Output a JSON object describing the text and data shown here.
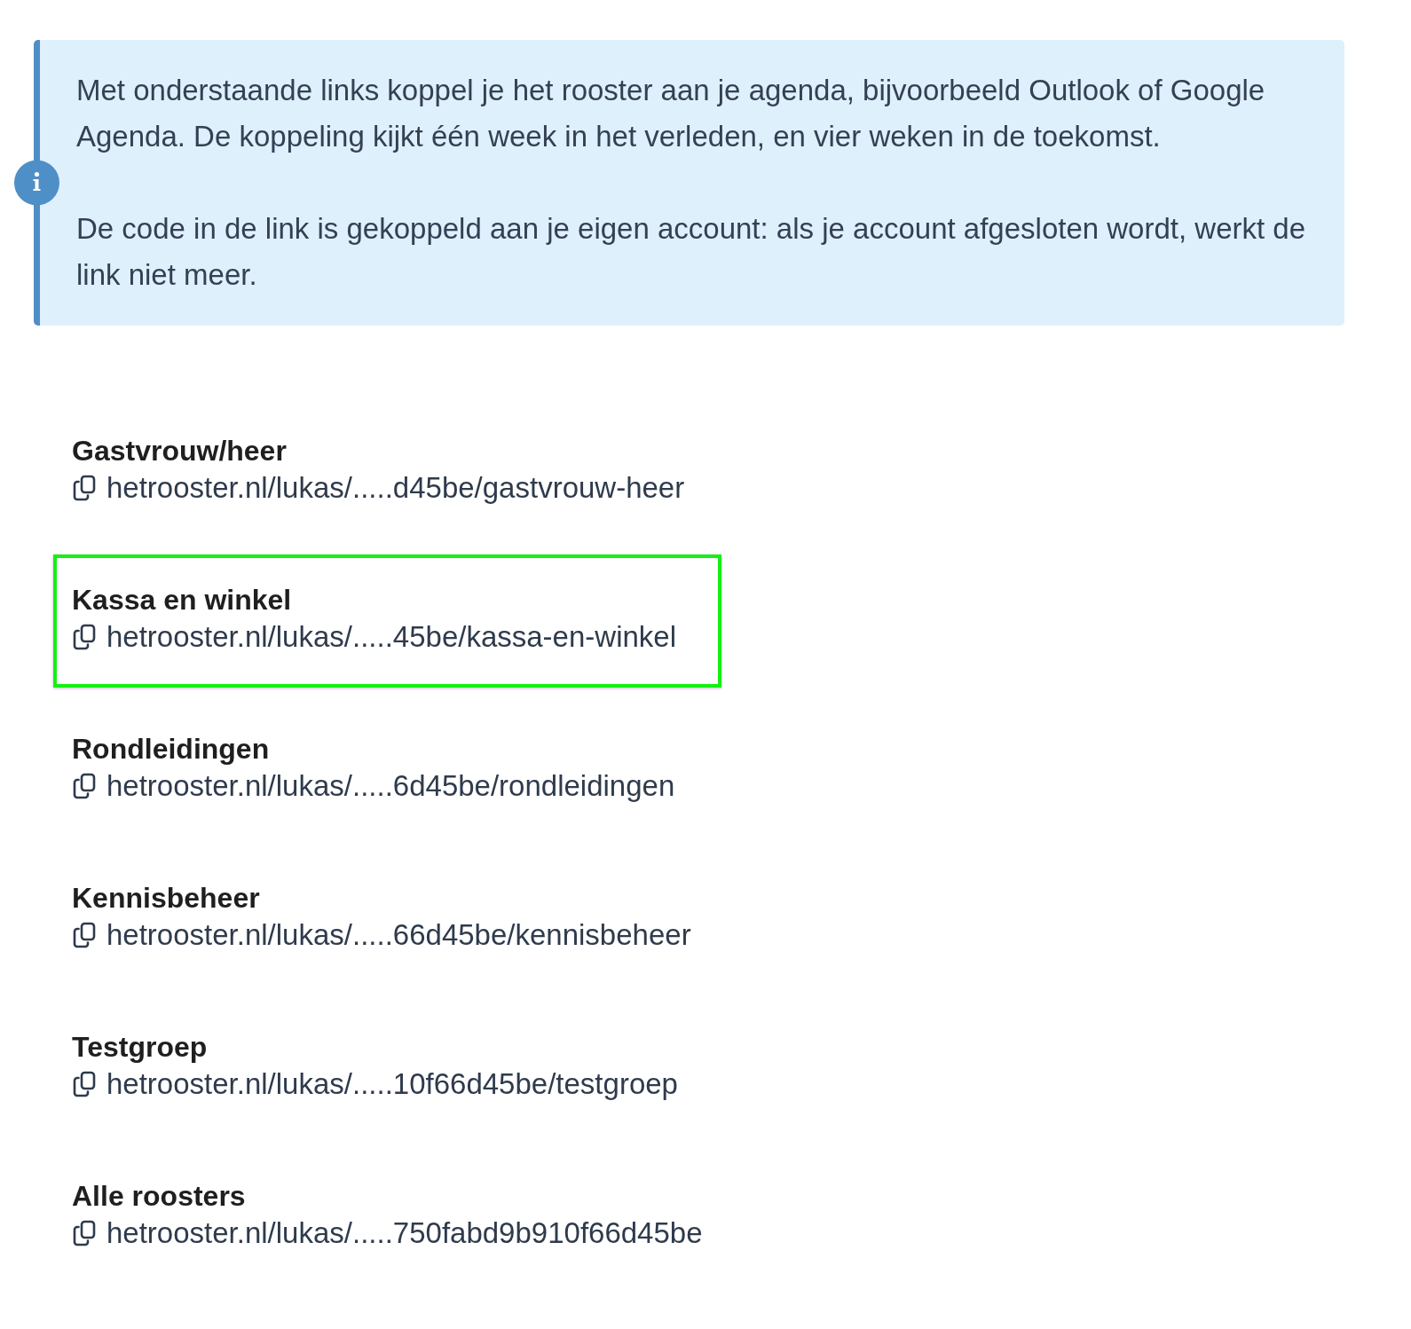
{
  "info": {
    "paragraphs": [
      "Met onderstaande links koppel je het rooster aan je agenda, bijvoorbeeld Outlook of Google Agenda. De koppeling kijkt één week in het verleden, en vier weken in de toekomst.",
      "De code in de link is gekoppeld aan je eigen account: als je account afgesloten wordt, werkt de link niet meer."
    ]
  },
  "calendars": [
    {
      "name": "Gastvrouw/heer",
      "link": "hetrooster.nl/lukas/.....d45be/gastvrouw-heer",
      "highlighted": false
    },
    {
      "name": "Kassa en winkel",
      "link": "hetrooster.nl/lukas/.....45be/kassa-en-winkel",
      "highlighted": true
    },
    {
      "name": "Rondleidingen",
      "link": "hetrooster.nl/lukas/.....6d45be/rondleidingen",
      "highlighted": false
    },
    {
      "name": "Kennisbeheer",
      "link": "hetrooster.nl/lukas/.....66d45be/kennisbeheer",
      "highlighted": false
    },
    {
      "name": "Testgroep",
      "link": "hetrooster.nl/lukas/.....10f66d45be/testgroep",
      "highlighted": false
    },
    {
      "name": "Alle roosters",
      "link": "hetrooster.nl/lukas/.....750fabd9b910f66d45be",
      "highlighted": false
    }
  ]
}
